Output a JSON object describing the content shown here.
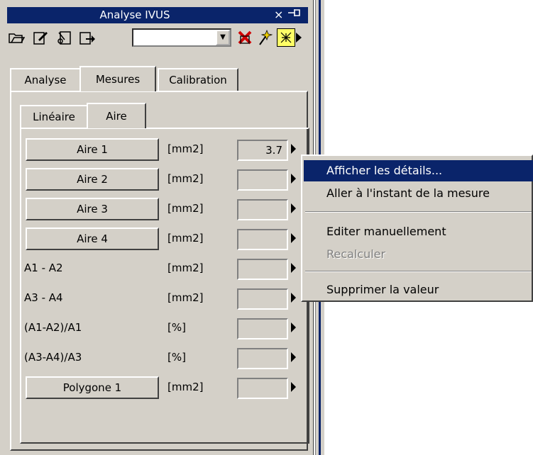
{
  "window": {
    "title": "Analyse IVUS",
    "close_glyph": "×",
    "pin_glyph": "⊣⊢"
  },
  "toolbar": {
    "icons": [
      "open-folder-icon",
      "edit-document-icon",
      "cut-document-icon",
      "export-icon",
      "delete-icon",
      "wand-icon",
      "toggle-icon",
      "more-arrow-icon"
    ],
    "combo_value": ""
  },
  "tabs": {
    "items": [
      "Analyse",
      "Mesures",
      "Calibration"
    ],
    "active": "Mesures"
  },
  "subtabs": {
    "items": [
      "Linéaire",
      "Aire"
    ],
    "active": "Aire"
  },
  "measurements": [
    {
      "label": "Aire 1",
      "unit": "[mm2]",
      "value": "3.7",
      "is_button": true
    },
    {
      "label": "Aire 2",
      "unit": "[mm2]",
      "value": "",
      "is_button": true
    },
    {
      "label": "Aire 3",
      "unit": "[mm2]",
      "value": "",
      "is_button": true
    },
    {
      "label": "Aire 4",
      "unit": "[mm2]",
      "value": "",
      "is_button": true
    },
    {
      "label": "A1 - A2",
      "unit": "[mm2]",
      "value": "",
      "is_button": false
    },
    {
      "label": "A3 - A4",
      "unit": "[mm2]",
      "value": "",
      "is_button": false
    },
    {
      "label": "(A1-A2)/A1",
      "unit": "[%]",
      "value": "",
      "is_button": false
    },
    {
      "label": "(A3-A4)/A3",
      "unit": "[%]",
      "value": "",
      "is_button": false
    },
    {
      "label": "Polygone 1",
      "unit": "[mm2]",
      "value": "",
      "is_button": true
    }
  ],
  "context_menu": {
    "items": [
      {
        "label": "Afficher les détails...",
        "state": "highlighted"
      },
      {
        "label": "Aller à l'instant de la mesure",
        "state": "normal"
      },
      {
        "label": "Editer manuellement",
        "state": "normal"
      },
      {
        "label": "Recalculer",
        "state": "disabled"
      },
      {
        "label": "Supprimer la valeur",
        "state": "normal"
      }
    ]
  },
  "colors": {
    "face": "#d4d0c8",
    "titlebar": "#0a246a",
    "highlight": "#0a246a"
  }
}
